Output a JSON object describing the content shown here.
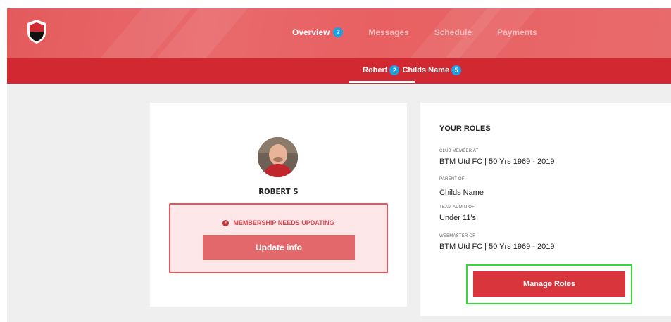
{
  "nav": {
    "items": [
      {
        "label": "Overview",
        "badge": "7",
        "active": true
      },
      {
        "label": "Messages",
        "badge": "",
        "active": false
      },
      {
        "label": "Schedule",
        "badge": "",
        "active": false
      },
      {
        "label": "Payments",
        "badge": "",
        "active": false
      }
    ]
  },
  "subnav": {
    "tab_label_1": "Robert",
    "tab_badge_1": "2",
    "tab_label_2": "Childs Name",
    "tab_badge_2": "5"
  },
  "profile": {
    "name": "ROBERT S",
    "alert_text": "MEMBERSHIP NEEDS UPDATING",
    "update_button": "Update info"
  },
  "roles": {
    "title": "YOUR ROLES",
    "items": [
      {
        "label": "CLUB MEMBER AT",
        "value": "BTM Utd FC | 50 Yrs 1969 - 2019"
      },
      {
        "label": "PARENT OF",
        "value": "Childs Name"
      },
      {
        "label": "TEAM ADMIN OF",
        "value": "Under 11's"
      },
      {
        "label": "WEBMASTER OF",
        "value": "BTM Utd FC | 50 Yrs 1969 - 2019"
      }
    ],
    "manage_button": "Manage Roles"
  },
  "colors": {
    "topbar": "#e8676a",
    "subbar": "#d12832",
    "badge": "#1aa0e6",
    "highlight": "#3bd63b"
  }
}
